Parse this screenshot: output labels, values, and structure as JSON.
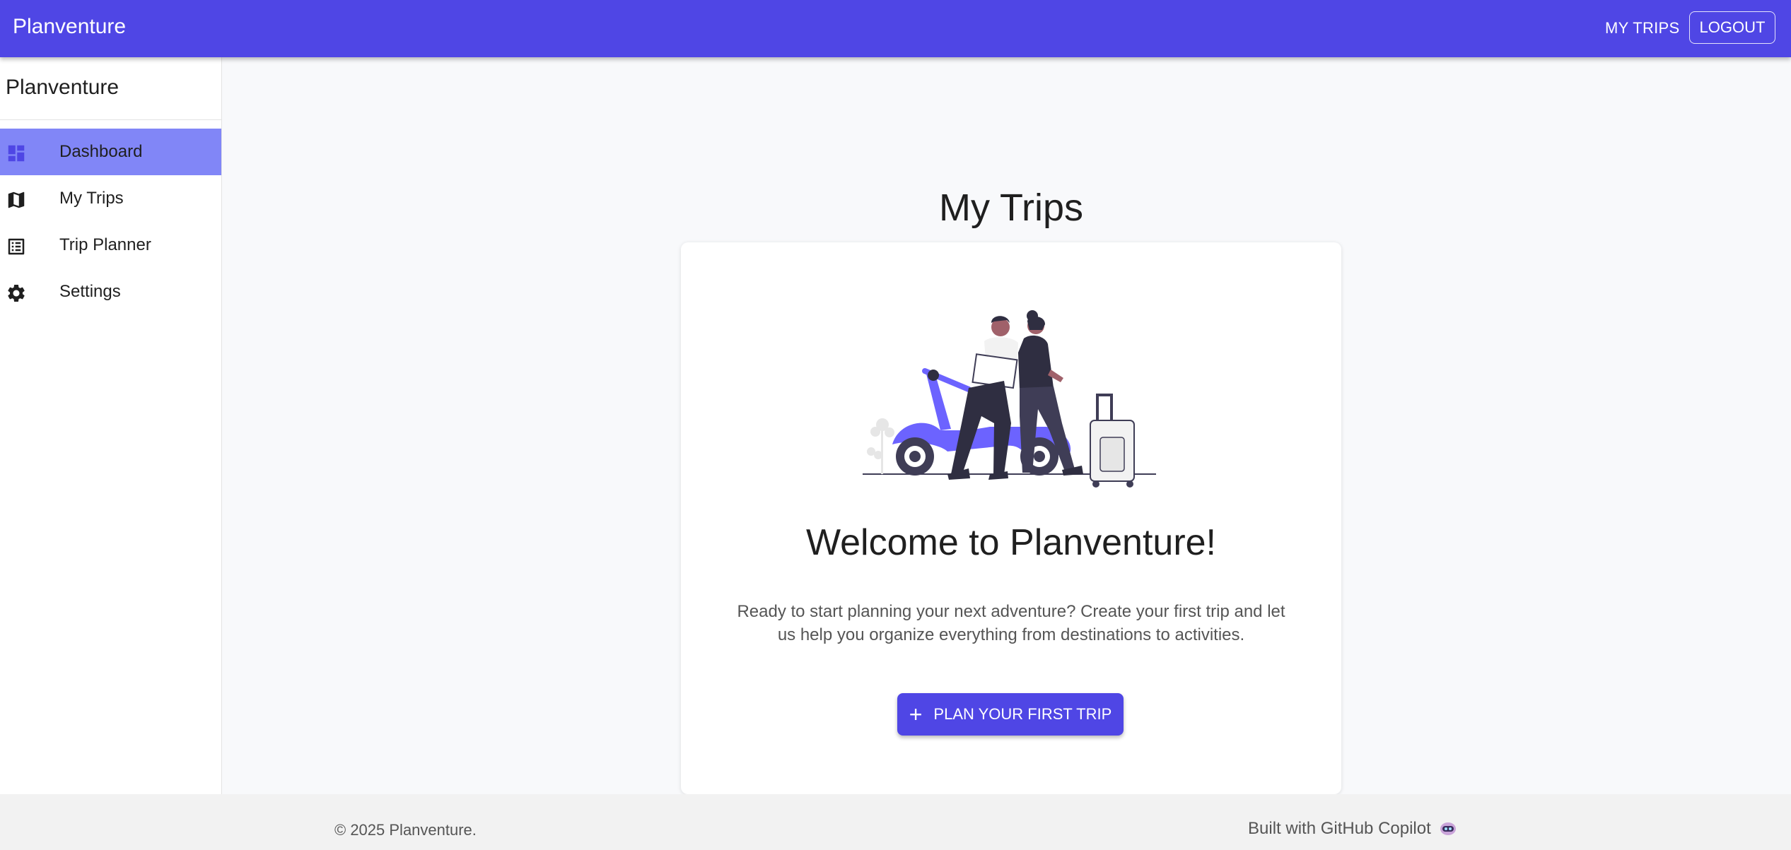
{
  "appbar": {
    "brand": "Planventure",
    "nav_my_trips": "MY TRIPS",
    "logout": "LOGOUT",
    "color": "#4f46e5"
  },
  "sidebar": {
    "title": "Planventure",
    "items": [
      {
        "label": "Dashboard",
        "icon": "dashboard-icon",
        "active": true
      },
      {
        "label": "My Trips",
        "icon": "map-icon",
        "active": false
      },
      {
        "label": "Trip Planner",
        "icon": "list-icon",
        "active": false
      },
      {
        "label": "Settings",
        "icon": "gear-icon",
        "active": false
      }
    ],
    "active_color": "#8186f7"
  },
  "main": {
    "title": "My Trips",
    "card": {
      "illustration": "scooter-travelers-illustration",
      "heading": "Welcome to Planventure!",
      "description": "Ready to start planning your next adventure? Create your first trip and let us help you organize everything from destinations to activities.",
      "cta_label": "PLAN YOUR FIRST TRIP",
      "cta_icon": "plus-icon"
    }
  },
  "footer": {
    "copyright": "© 2025 Planventure.",
    "built_with": "Built with GitHub Copilot",
    "built_icon": "copilot-icon"
  }
}
